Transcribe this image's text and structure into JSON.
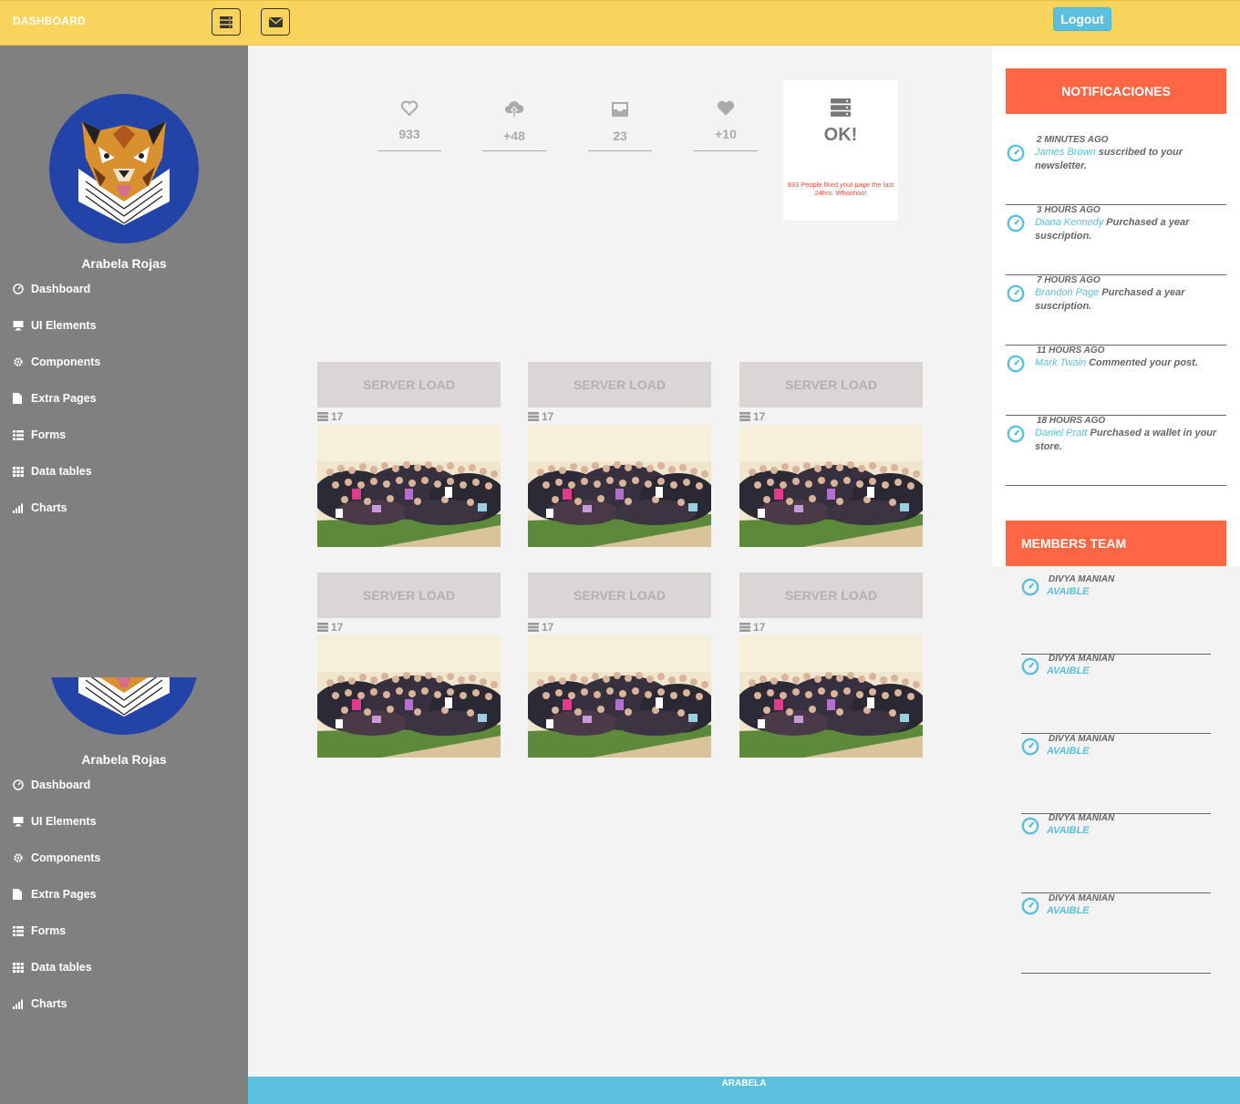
{
  "header": {
    "brand": "DASHBOARD",
    "logout_label": "Logout"
  },
  "sidebar": {
    "user_name": "Arabela Rojas",
    "menu": [
      {
        "label": "Dashboard",
        "icon": "dashboard-icon"
      },
      {
        "label": "UI Elements",
        "icon": "desktop-icon"
      },
      {
        "label": "Components",
        "icon": "gear-icon"
      },
      {
        "label": "Extra Pages",
        "icon": "file-icon"
      },
      {
        "label": "Forms",
        "icon": "list-icon"
      },
      {
        "label": "Data tables",
        "icon": "grid-icon"
      },
      {
        "label": "Charts",
        "icon": "signal-bars-icon"
      }
    ]
  },
  "stats": [
    {
      "value": "933",
      "icon": "heart-outline-icon"
    },
    {
      "value": "+48",
      "icon": "cloud-upload-icon"
    },
    {
      "value": "23",
      "icon": "inbox-icon"
    },
    {
      "value": "+10",
      "icon": "heart-icon"
    }
  ],
  "ok_card": {
    "title": "OK!",
    "message": "933 People liked you! page the last 24hrs. Whoohoo!"
  },
  "tiles": [
    {
      "title": "SERVER LOAD",
      "count": "17"
    },
    {
      "title": "SERVER LOAD",
      "count": "17"
    },
    {
      "title": "SERVER LOAD",
      "count": "17"
    },
    {
      "title": "SERVER LOAD",
      "count": "17"
    },
    {
      "title": "SERVER LOAD",
      "count": "17"
    },
    {
      "title": "SERVER LOAD",
      "count": "17"
    }
  ],
  "notifications": {
    "title": "NOTIFICACIONES",
    "items": [
      {
        "time": "2 MINUTES AGO",
        "who": "James Brown",
        "text": " suscribed to your newsletter."
      },
      {
        "time": "3 HOURS AGO",
        "who": "Diana Kennedy",
        "text": " Purchased a year suscription."
      },
      {
        "time": "7 HOURS AGO",
        "who": "Brandon Page",
        "text": " Purchased a year suscription."
      },
      {
        "time": "11 HOURS AGO",
        "who": "Mark Twain",
        "text": " Commented your post."
      },
      {
        "time": "18 HOURS AGO",
        "who": "Daniel Pratt",
        "text": " Purchased a wallet in your store."
      }
    ]
  },
  "members": {
    "title": "MEMBERS TEAM",
    "items": [
      {
        "name": "DIVYA MANIAN",
        "status": "AVAIBLE"
      },
      {
        "name": "DIVYA MANIAN",
        "status": "AVAIBLE"
      },
      {
        "name": "DIVYA MANIAN",
        "status": "AVAIBLE"
      },
      {
        "name": "DIVYA MANIAN",
        "status": "AVAIBLE"
      },
      {
        "name": "DIVYA MANIAN",
        "status": "AVAIBLE"
      }
    ]
  },
  "footer": {
    "text": "ARABELA"
  },
  "colors": {
    "topbar": "#f8d45c",
    "sidebar": "#808080",
    "accent": "#5bc0de",
    "panel_head": "#ff6644",
    "avatar_bg": "#2244a8"
  }
}
